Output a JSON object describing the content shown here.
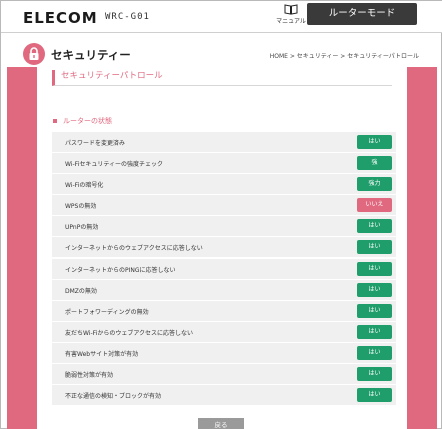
{
  "header": {
    "logo": "ELECOM",
    "model": "WRC-G01",
    "manual_label": "マニュアル",
    "mode_button": "ルーターモード"
  },
  "page": {
    "title": "セキュリティー",
    "breadcrumb": "HOME > セキュリティー > セキュリティーパトロール",
    "section_title": "セキュリティーパトロール",
    "status_heading": "ルーターの状態"
  },
  "checks": [
    {
      "label": "パスワードを変更済み",
      "status": "はい",
      "color": "#1f9e6b"
    },
    {
      "label": "Wi-Fiセキュリティーの強度チェック",
      "status": "強",
      "color": "#1f9e6b"
    },
    {
      "label": "Wi-Fiの暗号化",
      "status": "強力",
      "color": "#1f9e6b"
    },
    {
      "label": "WPSの無効",
      "status": "いいえ",
      "color": "#e0697f"
    },
    {
      "label": "UPnPの無効",
      "status": "はい",
      "color": "#1f9e6b"
    },
    {
      "label": "インターネットからのウェブアクセスに応答しない",
      "status": "はい",
      "color": "#1f9e6b"
    },
    {
      "label": "インターネットからのPINGに応答しない",
      "status": "はい",
      "color": "#1f9e6b"
    },
    {
      "label": "DMZの無効",
      "status": "はい",
      "color": "#1f9e6b"
    },
    {
      "label": "ポートフォワーディングの無効",
      "status": "はい",
      "color": "#1f9e6b"
    },
    {
      "label": "友だちWi-Fiからのウェブアクセスに応答しない",
      "status": "はい",
      "color": "#1f9e6b"
    },
    {
      "label": "有害Webサイト対策が有効",
      "status": "はい",
      "color": "#1f9e6b"
    },
    {
      "label": "脆弱性対策が有効",
      "status": "はい",
      "color": "#1f9e6b"
    },
    {
      "label": "不正な通信の検知・ブロックが有効",
      "status": "はい",
      "color": "#1f9e6b"
    }
  ],
  "footer": {
    "back_button": "戻る"
  },
  "colors": {
    "accent": "#e0697f",
    "ok": "#1f9e6b",
    "dark": "#3a3a3a"
  }
}
